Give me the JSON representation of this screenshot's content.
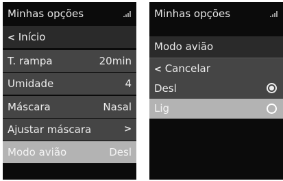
{
  "left_screen": {
    "title": "Minhas opções",
    "back_label": "Início",
    "items": [
      {
        "label": "T. rampa",
        "value": "20min"
      },
      {
        "label": "Umidade",
        "value": "4"
      },
      {
        "label": "Máscara",
        "value": "Nasal"
      },
      {
        "label": "Ajustar máscara",
        "value": ""
      },
      {
        "label": "Modo avião",
        "value": "Desl"
      }
    ],
    "selected_item": "Modo avião"
  },
  "right_screen": {
    "title": "Minhas opções",
    "section_header": "Modo avião",
    "cancel_label": "Cancelar",
    "options": [
      {
        "label": "Desl",
        "checked": true
      },
      {
        "label": "Lig",
        "checked": false
      }
    ],
    "highlighted_option": "Lig"
  },
  "icons": {
    "back": "chevron-left-icon",
    "forward": "chevron-right-icon",
    "signal": "signal-strength-icon",
    "radio_on": "radio-checked-icon",
    "radio_off": "radio-unchecked-icon"
  },
  "colors": {
    "screen_background": "#0b0b0b",
    "row_background": "#454545",
    "row_highlight": "#b3b3b3",
    "text": "#ececec"
  }
}
